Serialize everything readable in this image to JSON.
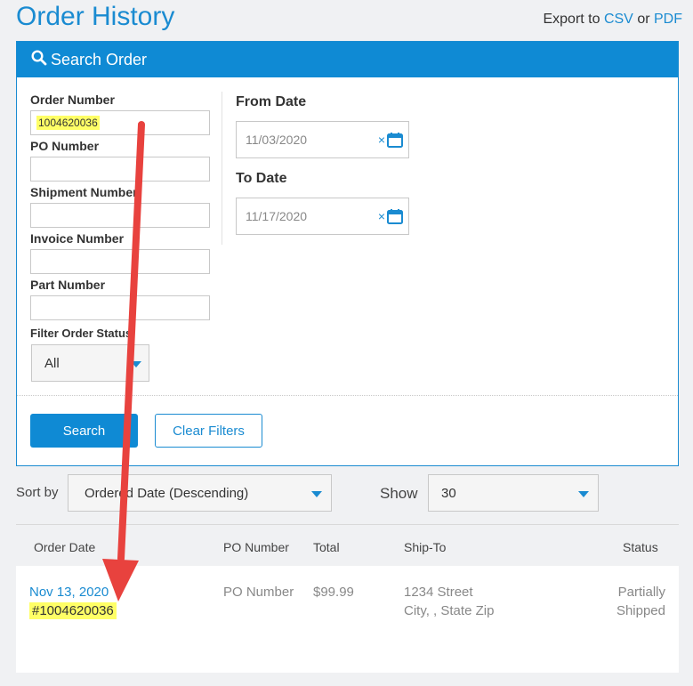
{
  "header": {
    "title": "Order History",
    "export_prefix": "Export to",
    "export_csv": "CSV",
    "export_or": "or",
    "export_pdf": "PDF"
  },
  "search": {
    "panel_title": "Search Order",
    "order_number_label": "Order Number",
    "order_number_value": "1004620036",
    "po_number_label": "PO Number",
    "po_number_value": "",
    "shipment_number_label": "Shipment Number",
    "shipment_number_value": "",
    "invoice_number_label": "Invoice Number",
    "invoice_number_value": "",
    "part_number_label": "Part Number",
    "part_number_value": "",
    "filter_status_label": "Filter Order Status",
    "filter_status_value": "All",
    "from_date_label": "From Date",
    "from_date_value": "11/03/2020",
    "to_date_label": "To Date",
    "to_date_value": "11/17/2020",
    "clear_glyph": "×",
    "search_button": "Search",
    "clear_button": "Clear Filters"
  },
  "sort": {
    "label": "Sort by",
    "value": "Ordered Date (Descending)"
  },
  "show": {
    "label": "Show",
    "value": "30"
  },
  "table": {
    "headers": [
      "Order Date",
      "PO Number",
      "Total",
      "Ship-To",
      "Status"
    ],
    "rows": [
      {
        "date": "Nov 13, 2020",
        "order_number": "#1004620036",
        "po_number": "PO Number",
        "total": "$99.99",
        "ship_to_line1": "1234 Street",
        "ship_to_line2": "City, , State Zip",
        "status_line1": "Partially",
        "status_line2": "Shipped"
      }
    ]
  },
  "colors": {
    "accent": "#1a8bd1",
    "header_bar": "#0f8ad4",
    "highlight": "#ffff66",
    "annotation_arrow": "#e8423e"
  },
  "icons": {
    "search": "search-icon",
    "calendar": "calendar-icon",
    "dropdown": "chevron-down-icon"
  }
}
